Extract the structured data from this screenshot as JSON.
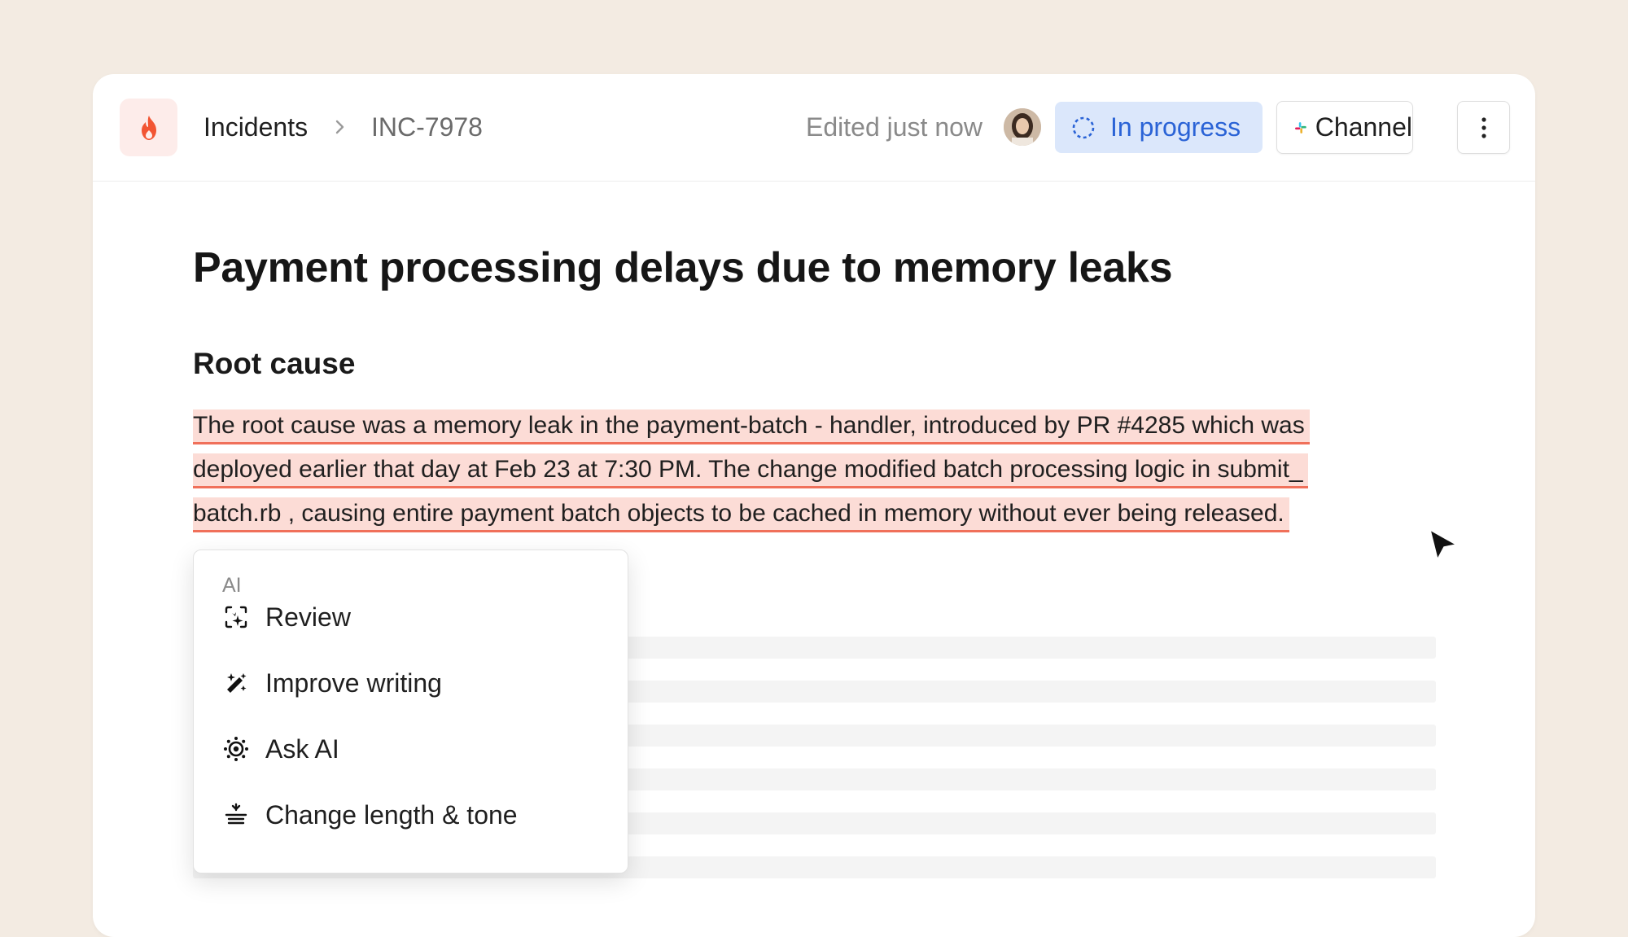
{
  "header": {
    "breadcrumb": [
      "Incidents",
      "INC-7978"
    ],
    "edited_text": "Edited just now",
    "status_label": "In progress",
    "channel_label": "Channel",
    "icons": [
      "flame-icon",
      "chevron-right-icon",
      "spinner-icon",
      "slack-icon",
      "more-vertical-icon"
    ]
  },
  "document": {
    "title": "Payment processing delays due to memory leaks",
    "section_heading": "Root cause",
    "highlighted_lines": [
      "The root cause was a memory leak in the payment-batch - handler, introduced by PR #4285 which was",
      "deployed earlier that day at Feb 23 at 7:30 PM. The change modified batch processing logic in submit_",
      "batch.rb , causing entire payment batch objects to be cached in memory without ever being released."
    ]
  },
  "ai_menu": {
    "heading": "AI",
    "items": [
      {
        "label": "Review",
        "icon": "review-sparkle-icon"
      },
      {
        "label": "Improve writing",
        "icon": "magic-wand-icon"
      },
      {
        "label": "Ask AI",
        "icon": "ai-chip-icon"
      },
      {
        "label": "Change length & tone",
        "icon": "length-tone-icon"
      }
    ]
  },
  "colors": {
    "background": "#f3ebe2",
    "highlight_fill": "#fcdcd6",
    "highlight_underline": "#f0705a",
    "status_bg": "#dbe7fb",
    "status_text": "#2a63d6",
    "brand_flame": "#f25533"
  }
}
